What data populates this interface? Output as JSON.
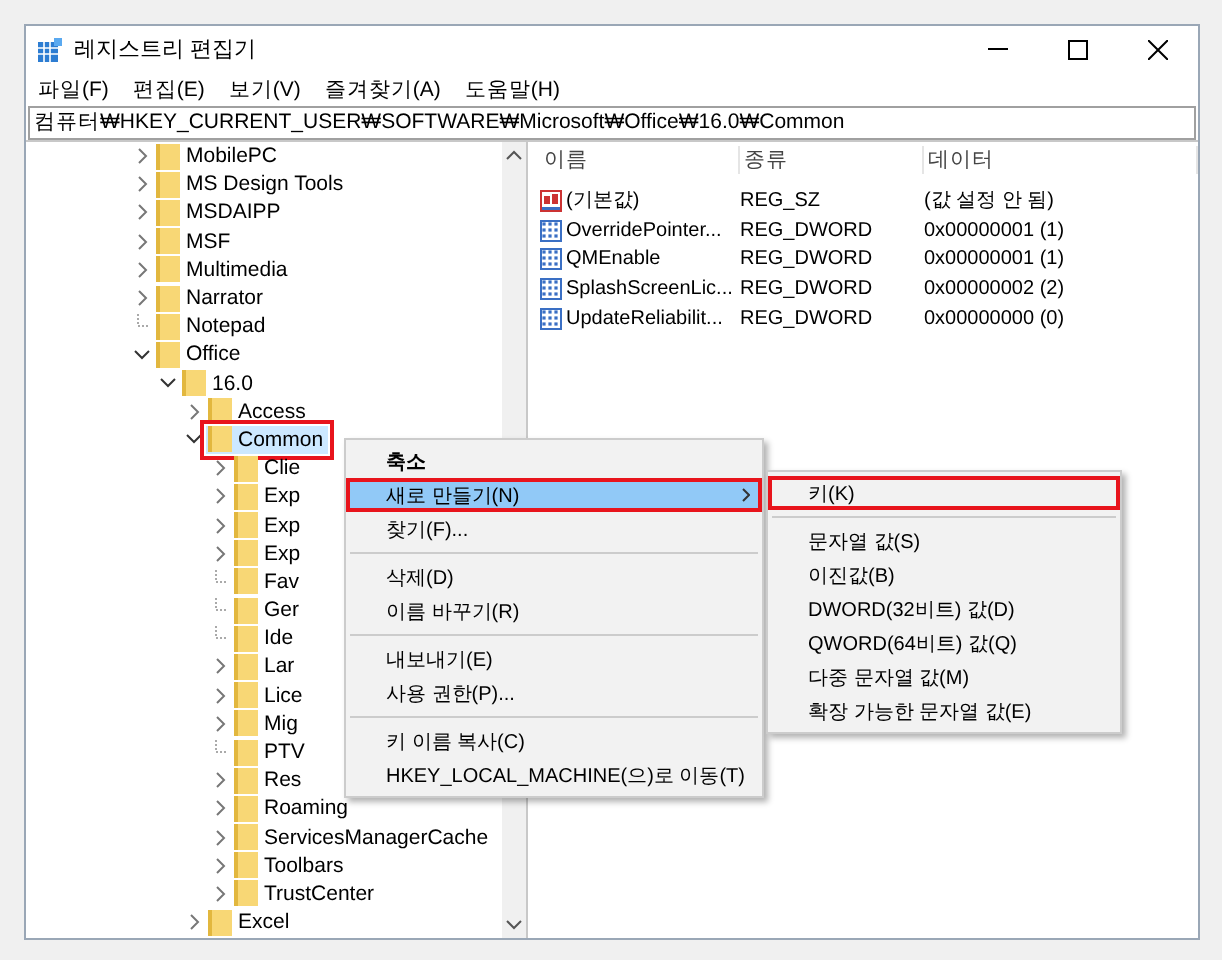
{
  "window": {
    "title": "레지스트리 편집기"
  },
  "menu_bar": [
    "파일(F)",
    "편집(E)",
    "보기(V)",
    "즐겨찾기(A)",
    "도움말(H)"
  ],
  "address": "컴퓨터₩HKEY_CURRENT_USER₩SOFTWARE₩Microsoft₩Office₩16.0₩Common",
  "tree": [
    {
      "label": "MobilePC",
      "has_children": true,
      "expanded": false,
      "selected": false,
      "annotated": false
    },
    {
      "label": "MS Design Tools",
      "has_children": true,
      "expanded": false,
      "selected": false,
      "annotated": false
    },
    {
      "label": "MSDAIPP",
      "has_children": true,
      "expanded": false,
      "selected": false,
      "annotated": false
    },
    {
      "label": "MSF",
      "has_children": true,
      "expanded": false,
      "selected": false,
      "annotated": false
    },
    {
      "label": "Multimedia",
      "has_children": true,
      "expanded": false,
      "selected": false,
      "annotated": false
    },
    {
      "label": "Narrator",
      "has_children": true,
      "expanded": false,
      "selected": false,
      "annotated": false
    },
    {
      "label": "Notepad",
      "has_children": false,
      "selected": false,
      "annotated": false
    },
    {
      "label": "Office",
      "has_children": true,
      "expanded": true,
      "selected": false,
      "annotated": false,
      "children": [
        {
          "label": "16.0",
          "has_children": true,
          "expanded": true,
          "selected": false,
          "annotated": false,
          "children": [
            {
              "label": "Access",
              "has_children": true,
              "expanded": false,
              "selected": false,
              "annotated": false
            },
            {
              "label": "Common",
              "has_children": true,
              "expanded": true,
              "selected": true,
              "annotated": true,
              "children": [
                {
                  "label": "Clie",
                  "has_children": true,
                  "expanded": false,
                  "selected": false,
                  "annotated": false
                },
                {
                  "label": "Exp",
                  "has_children": true,
                  "expanded": false,
                  "selected": false,
                  "annotated": false
                },
                {
                  "label": "Exp",
                  "has_children": true,
                  "expanded": false,
                  "selected": false,
                  "annotated": false
                },
                {
                  "label": "Exp",
                  "has_children": true,
                  "expanded": false,
                  "selected": false,
                  "annotated": false
                },
                {
                  "label": "Fav",
                  "has_children": false,
                  "selected": false,
                  "annotated": false
                },
                {
                  "label": "Ger",
                  "has_children": false,
                  "selected": false,
                  "annotated": false
                },
                {
                  "label": "Ide",
                  "has_children": false,
                  "selected": false,
                  "annotated": false
                },
                {
                  "label": "Lar",
                  "has_children": true,
                  "expanded": false,
                  "selected": false,
                  "annotated": false
                },
                {
                  "label": "Lice",
                  "has_children": true,
                  "expanded": false,
                  "selected": false,
                  "annotated": false
                },
                {
                  "label": "Mig",
                  "has_children": true,
                  "expanded": false,
                  "selected": false,
                  "annotated": false
                },
                {
                  "label": "PTV",
                  "has_children": false,
                  "selected": false,
                  "annotated": false
                },
                {
                  "label": "Res",
                  "has_children": true,
                  "expanded": false,
                  "selected": false,
                  "annotated": false
                },
                {
                  "label": "Roaming",
                  "has_children": true,
                  "expanded": false,
                  "selected": false,
                  "annotated": false
                },
                {
                  "label": "ServicesManagerCache",
                  "has_children": true,
                  "expanded": false,
                  "selected": false,
                  "annotated": false
                },
                {
                  "label": "Toolbars",
                  "has_children": true,
                  "expanded": false,
                  "selected": false,
                  "annotated": false
                },
                {
                  "label": "TrustCenter",
                  "has_children": true,
                  "expanded": false,
                  "selected": false,
                  "annotated": false
                }
              ]
            },
            {
              "label": "Excel",
              "has_children": true,
              "expanded": false,
              "selected": false,
              "annotated": false
            }
          ]
        }
      ]
    }
  ],
  "values": {
    "columns": [
      "이름",
      "종류",
      "데이터"
    ],
    "rows": [
      {
        "kind": "string",
        "name": "(기본값)",
        "type_text": "REG_SZ",
        "data": "(값 설정 안 됨)"
      },
      {
        "kind": "binary",
        "name": "OverridePointer...",
        "type_text": "REG_DWORD",
        "data": "0x00000001 (1)"
      },
      {
        "kind": "binary",
        "name": "QMEnable",
        "type_text": "REG_DWORD",
        "data": "0x00000001 (1)"
      },
      {
        "kind": "binary",
        "name": "SplashScreenLic...",
        "type_text": "REG_DWORD",
        "data": "0x00000002 (2)"
      },
      {
        "kind": "binary",
        "name": "UpdateReliabilit...",
        "type_text": "REG_DWORD",
        "data": "0x00000000 (0)"
      }
    ]
  },
  "context_menu": [
    {
      "kind": "item",
      "label": "축소",
      "bold": true,
      "highlighted": false,
      "annotated": false,
      "submenu": false
    },
    {
      "kind": "item",
      "label": "새로 만들기(N)",
      "bold": false,
      "highlighted": true,
      "annotated": true,
      "submenu": true
    },
    {
      "kind": "item",
      "label": "찾기(F)...",
      "bold": false,
      "highlighted": false,
      "annotated": false,
      "submenu": false
    },
    {
      "kind": "separator"
    },
    {
      "kind": "item",
      "label": "삭제(D)",
      "bold": false,
      "highlighted": false,
      "annotated": false,
      "submenu": false
    },
    {
      "kind": "item",
      "label": "이름 바꾸기(R)",
      "bold": false,
      "highlighted": false,
      "annotated": false,
      "submenu": false
    },
    {
      "kind": "separator"
    },
    {
      "kind": "item",
      "label": "내보내기(E)",
      "bold": false,
      "highlighted": false,
      "annotated": false,
      "submenu": false
    },
    {
      "kind": "item",
      "label": "사용 권한(P)...",
      "bold": false,
      "highlighted": false,
      "annotated": false,
      "submenu": false
    },
    {
      "kind": "separator"
    },
    {
      "kind": "item",
      "label": "키 이름 복사(C)",
      "bold": false,
      "highlighted": false,
      "annotated": false,
      "submenu": false
    },
    {
      "kind": "item",
      "label": "HKEY_LOCAL_MACHINE(으)로 이동(T)",
      "bold": false,
      "highlighted": false,
      "annotated": false,
      "submenu": false
    }
  ],
  "submenu": [
    {
      "kind": "item",
      "label": "키(K)",
      "highlighted": false,
      "annotated": true
    },
    {
      "kind": "separator"
    },
    {
      "kind": "item",
      "label": "문자열 값(S)",
      "highlighted": false,
      "annotated": false
    },
    {
      "kind": "item",
      "label": "이진값(B)",
      "highlighted": false,
      "annotated": false
    },
    {
      "kind": "item",
      "label": "DWORD(32비트) 값(D)",
      "highlighted": false,
      "annotated": false
    },
    {
      "kind": "item",
      "label": "QWORD(64비트) 값(Q)",
      "highlighted": false,
      "annotated": false
    },
    {
      "kind": "item",
      "label": "다중 문자열 값(M)",
      "highlighted": false,
      "annotated": false
    },
    {
      "kind": "item",
      "label": "확장 가능한 문자열 값(E)",
      "highlighted": false,
      "annotated": false
    }
  ]
}
